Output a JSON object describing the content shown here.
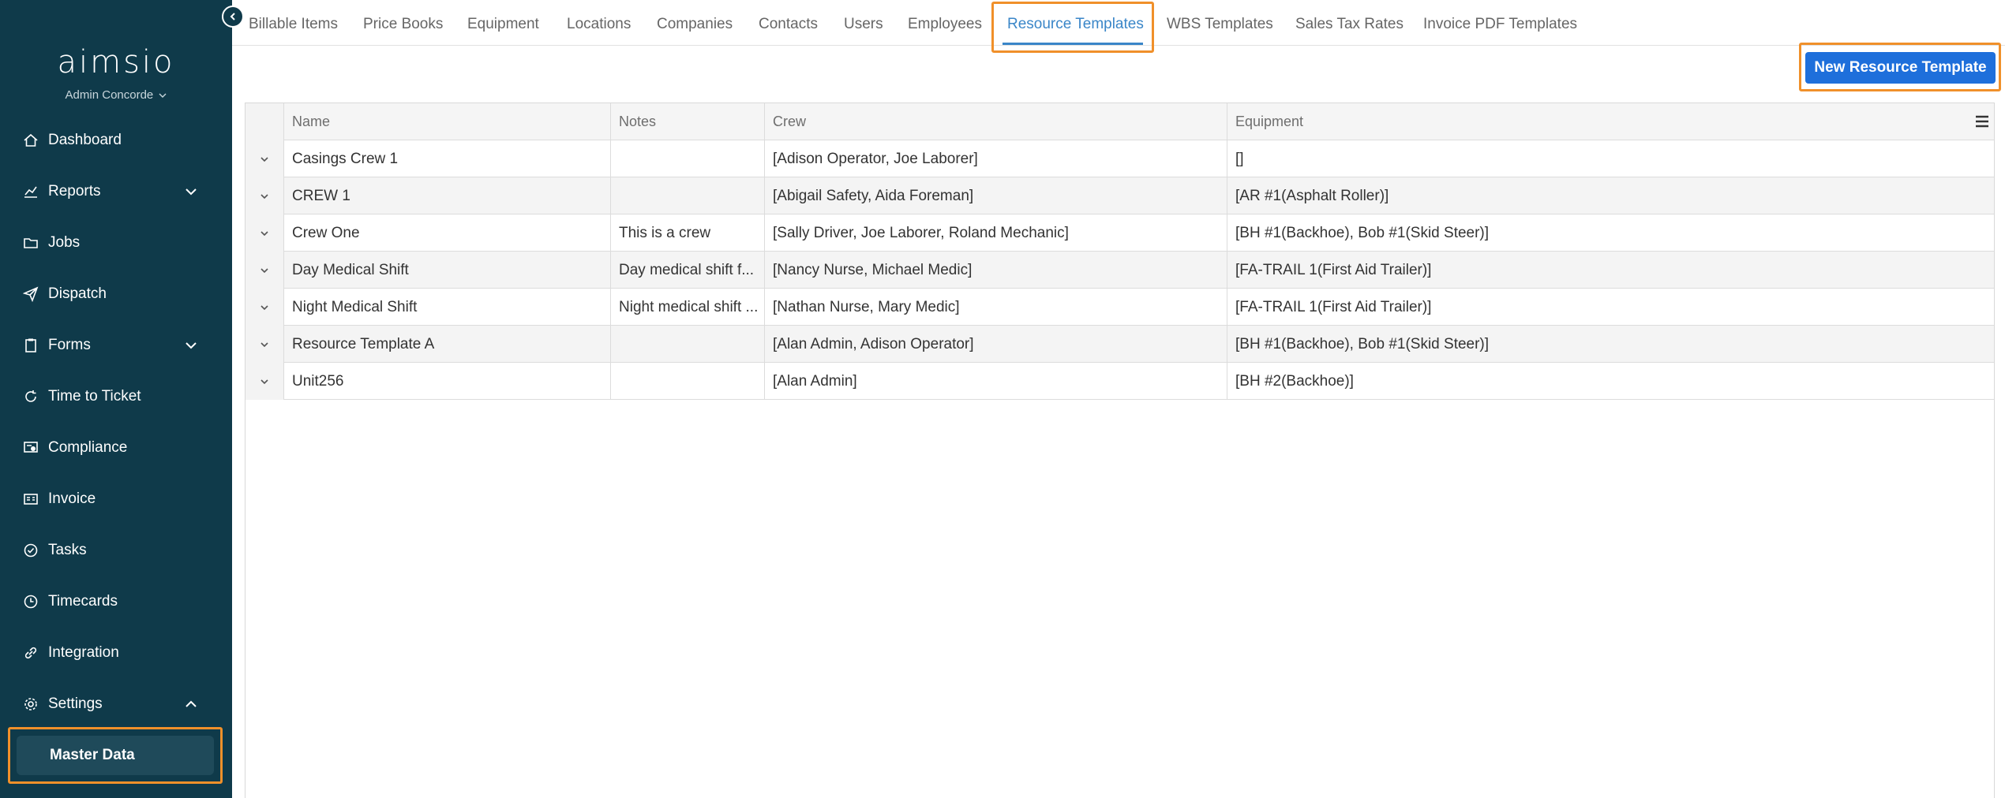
{
  "app": {
    "logo": "aimsio",
    "account": "Admin Concorde"
  },
  "sidebar": {
    "items": [
      {
        "label": "Dashboard",
        "icon": "home-icon"
      },
      {
        "label": "Reports",
        "icon": "chart-icon"
      },
      {
        "label": "Jobs",
        "icon": "folder-icon"
      },
      {
        "label": "Dispatch",
        "icon": "send-icon"
      },
      {
        "label": "Forms",
        "icon": "clipboard-icon"
      },
      {
        "label": "Time to Ticket",
        "icon": "refresh-icon"
      },
      {
        "label": "Compliance",
        "icon": "certificate-icon"
      },
      {
        "label": "Invoice",
        "icon": "invoice-icon"
      },
      {
        "label": "Tasks",
        "icon": "check-circle-icon"
      },
      {
        "label": "Timecards",
        "icon": "clock-icon"
      },
      {
        "label": "Integration",
        "icon": "link-icon"
      },
      {
        "label": "Settings",
        "icon": "gear-icon"
      }
    ],
    "active_sub_item": "Master Data"
  },
  "tabs": [
    "Billable Items",
    "Price Books",
    "Equipment",
    "Locations",
    "Companies",
    "Contacts",
    "Users",
    "Employees",
    "Resource Templates",
    "WBS Templates",
    "Sales Tax Rates",
    "Invoice PDF Templates"
  ],
  "active_tab": "Resource Templates",
  "toolbar": {
    "new_button": "New Resource Template"
  },
  "grid": {
    "columns": {
      "name": "Name",
      "notes": "Notes",
      "crew": "Crew",
      "equipment": "Equipment"
    },
    "rows": [
      {
        "name": "Casings Crew 1",
        "notes": "",
        "crew": "[Adison Operator, Joe Laborer]",
        "equipment": "[]"
      },
      {
        "name": "CREW 1",
        "notes": "",
        "crew": "[Abigail Safety, Aida Foreman]",
        "equipment": "[AR #1(Asphalt Roller)]"
      },
      {
        "name": "Crew One",
        "notes": "This is a crew",
        "crew": "[Sally Driver, Joe Laborer, Roland Mechanic]",
        "equipment": "[BH #1(Backhoe), Bob #1(Skid Steer)]"
      },
      {
        "name": "Day Medical Shift",
        "notes": "Day medical shift f...",
        "crew": "[Nancy Nurse, Michael Medic]",
        "equipment": "[FA-TRAIL 1(First Aid Trailer)]"
      },
      {
        "name": "Night Medical Shift",
        "notes": "Night medical shift ...",
        "crew": "[Nathan Nurse, Mary Medic]",
        "equipment": "[FA-TRAIL 1(First Aid Trailer)]"
      },
      {
        "name": "Resource Template A",
        "notes": "",
        "crew": "[Alan Admin, Adison Operator]",
        "equipment": "[BH #1(Backhoe), Bob #1(Skid Steer)]"
      },
      {
        "name": "Unit256",
        "notes": "",
        "crew": "[Alan Admin]",
        "equipment": "[BH #2(Backhoe)]"
      }
    ]
  },
  "colors": {
    "sidebar_bg": "#0f3a4a",
    "accent_blue": "#1e6fdb",
    "highlight_orange": "#f0902a",
    "active_tab": "#3a86c8"
  }
}
